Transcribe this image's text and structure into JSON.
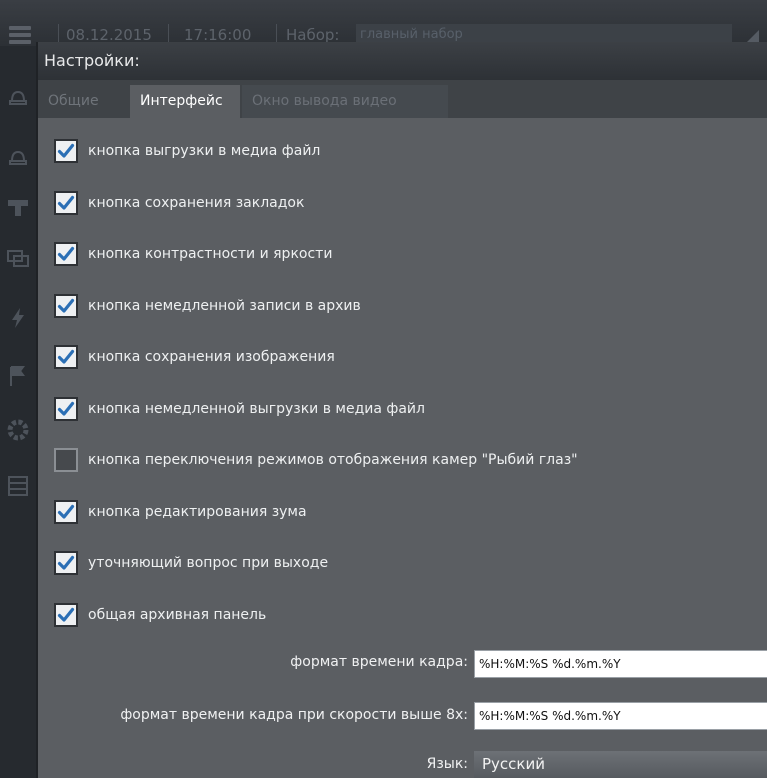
{
  "background": {
    "date": "08.12.2015",
    "time": "17:16:00",
    "set_label": "Набор:",
    "set_value": "главный набор"
  },
  "dialog": {
    "title": "Настройки:",
    "tabs": [
      {
        "label": "Общие"
      },
      {
        "label": "Интерфейс"
      },
      {
        "label": "Окно вывода видео"
      }
    ],
    "active_tab": "Интерфейс",
    "options": [
      {
        "label": "кнопка выгрузки в медиа файл",
        "checked": true
      },
      {
        "label": "кнопка сохранения закладок",
        "checked": true
      },
      {
        "label": "кнопка контрастности и яркости",
        "checked": true
      },
      {
        "label": "кнопка немедленной записи в архив",
        "checked": true
      },
      {
        "label": "кнопка сохранения изображения",
        "checked": true
      },
      {
        "label": "кнопка немедленной выгрузки в медиа файл",
        "checked": true
      },
      {
        "label": "кнопка переключения режимов отображения камер \"Рыбий глаз\"",
        "checked": false
      },
      {
        "label": "кнопка редактирования зума",
        "checked": true
      },
      {
        "label": "уточняющий вопрос при выходе",
        "checked": true
      },
      {
        "label": "общая архивная панель",
        "checked": true
      }
    ],
    "frame_time_format": {
      "label": "формат времени кадра:",
      "value": "%H:%M:%S %d.%m.%Y"
    },
    "frame_time_format_fast": {
      "label": "формат времени кадра при скорости выше 8х:",
      "value": "%H:%M:%S %d.%m.%Y"
    },
    "language": {
      "label": "Язык:",
      "value": "Русский"
    }
  },
  "colors": {
    "dialog_bg": "#5b5e62",
    "checkbox_check": "#2b6fb5"
  }
}
